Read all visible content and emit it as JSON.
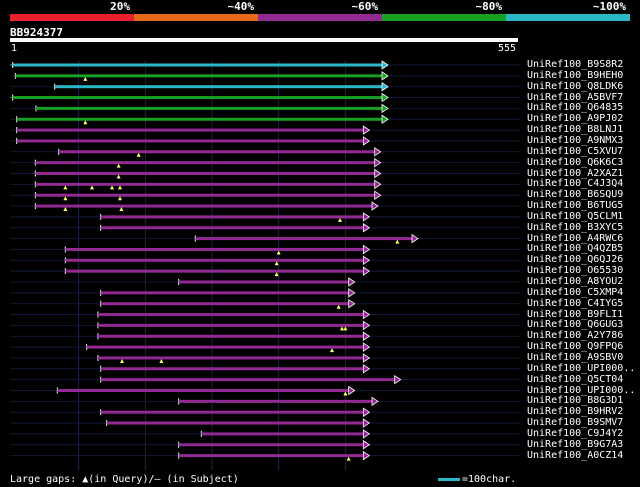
{
  "identity_legend": [
    {
      "label": "20%",
      "color": "#e8212c"
    },
    {
      "label": "~40%",
      "color": "#e66a18"
    },
    {
      "label": "~60%",
      "color": "#932a94"
    },
    {
      "label": "~80%",
      "color": "#17a022"
    },
    {
      "label": "~100%",
      "color": "#2ab7c8"
    }
  ],
  "query": {
    "id": "BB924377",
    "start": "1",
    "end": "555",
    "length": 555
  },
  "hits": [
    {
      "name": "UniRef100_B9S8R2",
      "color": "#2ab7c8",
      "qs": 1,
      "qe": 555,
      "ld": true,
      "gaps": []
    },
    {
      "name": "UniRef100_B9HEH0",
      "color": "#17a022",
      "qs": 5,
      "qe": 555,
      "ld": false,
      "gaps": [
        110
      ]
    },
    {
      "name": "UniRef100_Q8LDK6",
      "color": "#2ab7c8",
      "qs": 64,
      "qe": 555,
      "ld": false,
      "gaps": []
    },
    {
      "name": "UniRef100_A5BVF7",
      "color": "#17a022",
      "qs": 1,
      "qe": 555,
      "ld": true,
      "gaps": []
    },
    {
      "name": "UniRef100_Q64835",
      "color": "#17a022",
      "qs": 36,
      "qe": 555,
      "ld": false,
      "gaps": []
    },
    {
      "name": "UniRef100_A9PJ02",
      "color": "#17a022",
      "qs": 7,
      "qe": 555,
      "ld": false,
      "gaps": [
        110
      ]
    },
    {
      "name": "UniRef100_B8LNJ1",
      "color": "#932a94",
      "qs": 7,
      "qe": 527,
      "ld": false,
      "gaps": []
    },
    {
      "name": "UniRef100_A9NMX3",
      "color": "#932a94",
      "qs": 7,
      "qe": 527,
      "ld": false,
      "gaps": []
    },
    {
      "name": "UniRef100_C5XVU7",
      "color": "#932a94",
      "qs": 70,
      "qe": 544,
      "ld": false,
      "gaps": [
        190
      ]
    },
    {
      "name": "UniRef100_Q6K6C3",
      "color": "#932a94",
      "qs": 35,
      "qe": 544,
      "ld": false,
      "gaps": [
        160
      ]
    },
    {
      "name": "UniRef100_A2XAZ1",
      "color": "#932a94",
      "qs": 35,
      "qe": 544,
      "ld": false,
      "gaps": [
        160
      ]
    },
    {
      "name": "UniRef100_C4J3Q4",
      "color": "#932a94",
      "qs": 35,
      "qe": 544,
      "ld": false,
      "gaps": [
        80,
        120,
        150,
        162
      ]
    },
    {
      "name": "UniRef100_B6SQU9",
      "color": "#932a94",
      "qs": 35,
      "qe": 544,
      "ld": false,
      "gaps": [
        80,
        162
      ]
    },
    {
      "name": "UniRef100_B6TUG5",
      "color": "#932a94",
      "qs": 35,
      "qe": 540,
      "ld": false,
      "gaps": [
        80,
        164
      ]
    },
    {
      "name": "UniRef100_Q5CLM1",
      "color": "#932a94",
      "qs": 133,
      "qe": 527,
      "ld": false,
      "gaps": [
        492
      ]
    },
    {
      "name": "UniRef100_B3XYC5",
      "color": "#932a94",
      "qs": 133,
      "qe": 527,
      "ld": false,
      "gaps": []
    },
    {
      "name": "UniRef100_A4RWC6",
      "color": "#932a94",
      "qs": 275,
      "qe": 600,
      "ld": false,
      "gaps": [
        578
      ]
    },
    {
      "name": "UniRef100_Q4QZB5",
      "color": "#932a94",
      "qs": 80,
      "qe": 527,
      "ld": false,
      "gaps": [
        400
      ]
    },
    {
      "name": "UniRef100_Q6QJ26",
      "color": "#932a94",
      "qs": 80,
      "qe": 527,
      "ld": false,
      "gaps": [
        397
      ]
    },
    {
      "name": "UniRef100_O65530",
      "color": "#932a94",
      "qs": 80,
      "qe": 527,
      "ld": false,
      "gaps": [
        397
      ]
    },
    {
      "name": "UniRef100_A8YOU2",
      "color": "#932a94",
      "qs": 250,
      "qe": 505,
      "ld": false,
      "gaps": []
    },
    {
      "name": "UniRef100_C5XMP4",
      "color": "#932a94",
      "qs": 133,
      "qe": 505,
      "ld": false,
      "gaps": []
    },
    {
      "name": "UniRef100_C4IYG5",
      "color": "#932a94",
      "qs": 133,
      "qe": 505,
      "ld": false,
      "gaps": [
        490
      ]
    },
    {
      "name": "UniRef100_B9FLI1",
      "color": "#932a94",
      "qs": 129,
      "qe": 527,
      "ld": false,
      "gaps": []
    },
    {
      "name": "UniRef100_Q6GUG3",
      "color": "#932a94",
      "qs": 129,
      "qe": 527,
      "ld": false,
      "gaps": [
        495,
        500
      ]
    },
    {
      "name": "UniRef100_A2Y786",
      "color": "#932a94",
      "qs": 129,
      "qe": 527,
      "ld": false,
      "gaps": []
    },
    {
      "name": "UniRef100_Q9FPQ6",
      "color": "#932a94",
      "qs": 112,
      "qe": 527,
      "ld": false,
      "gaps": [
        480
      ]
    },
    {
      "name": "UniRef100_A9SBV0",
      "color": "#932a94",
      "qs": 129,
      "qe": 527,
      "ld": false,
      "gaps": [
        165,
        224
      ]
    },
    {
      "name": "UniRef100_UPI000..",
      "color": "#932a94",
      "qs": 133,
      "qe": 527,
      "ld": false,
      "gaps": []
    },
    {
      "name": "UniRef100_Q5CT04",
      "color": "#932a94",
      "qs": 133,
      "qe": 574,
      "ld": false,
      "gaps": []
    },
    {
      "name": "UniRef100_UPI000..",
      "color": "#932a94",
      "qs": 68,
      "qe": 505,
      "ld": false,
      "gaps": [
        500
      ]
    },
    {
      "name": "UniRef100_B8G3D1",
      "color": "#932a94",
      "qs": 250,
      "qe": 540,
      "ld": false,
      "gaps": []
    },
    {
      "name": "UniRef100_B9HRV2",
      "color": "#932a94",
      "qs": 133,
      "qe": 527,
      "ld": false,
      "gaps": []
    },
    {
      "name": "UniRef100_B9SMV7",
      "color": "#932a94",
      "qs": 142,
      "qe": 527,
      "ld": false,
      "gaps": []
    },
    {
      "name": "UniRef100_C9J4Y2",
      "color": "#932a94",
      "qs": 284,
      "qe": 527,
      "ld": false,
      "gaps": []
    },
    {
      "name": "UniRef100_B9G7A3",
      "color": "#932a94",
      "qs": 250,
      "qe": 527,
      "ld": false,
      "gaps": []
    },
    {
      "name": "UniRef100_A0CZ14",
      "color": "#932a94",
      "qs": 250,
      "qe": 527,
      "ld": false,
      "gaps": [
        505
      ]
    }
  ],
  "footer": {
    "gaps_text": "Large gaps: ▲(in Query)/– (in Subject)",
    "scale_text": "=100char."
  }
}
